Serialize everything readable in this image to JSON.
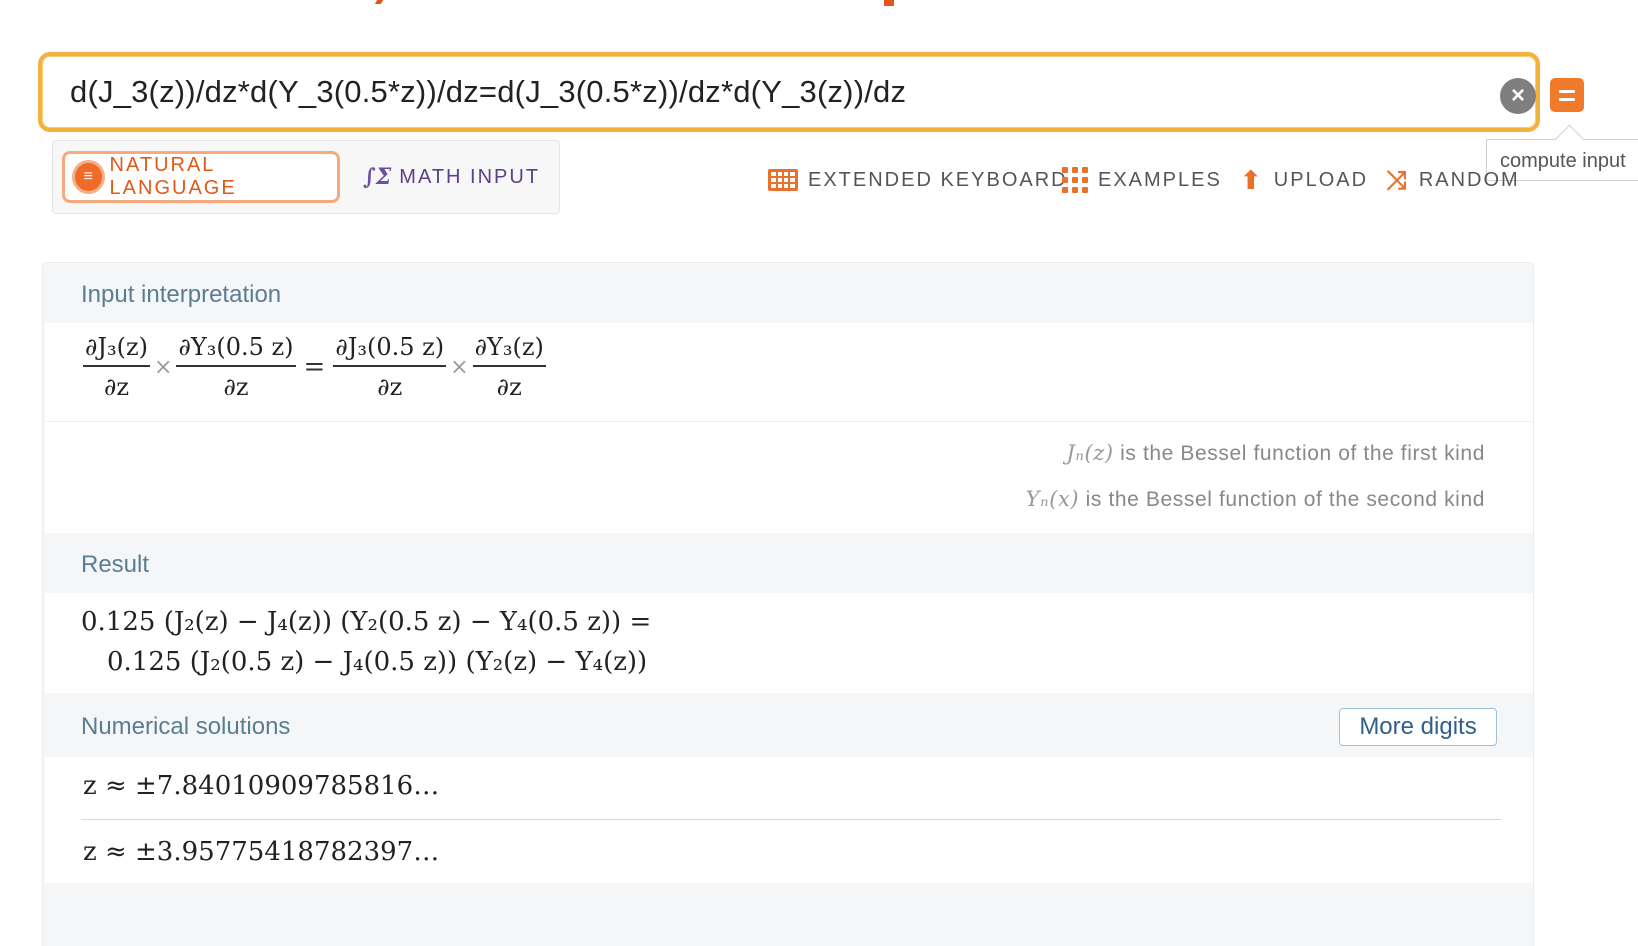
{
  "search": {
    "query": "d(J_3(z))/dz*d(Y_3(0.5*z))/dz=d(J_3(0.5*z))/dz*d(Y_3(z))/dz",
    "clear_icon": "close-icon",
    "compute_icon": "equals-icon",
    "tooltip": "compute input"
  },
  "modes": {
    "natural_language": "NATURAL LANGUAGE",
    "math_input": "MATH INPUT",
    "active": "natural_language"
  },
  "toolbar": {
    "extended_keyboard": "EXTENDED KEYBOARD",
    "examples": "EXAMPLES",
    "upload": "UPLOAD",
    "random": "RANDOM"
  },
  "pods": {
    "input_interpretation": {
      "title": "Input interpretation",
      "terms": [
        {
          "num": "∂J₃(z)",
          "den": "∂z"
        },
        {
          "num": "∂Y₃(0.5 z)",
          "den": "∂z"
        },
        {
          "num": "∂J₃(0.5 z)",
          "den": "∂z"
        },
        {
          "num": "∂Y₃(z)",
          "den": "∂z"
        }
      ],
      "times": "×",
      "equals": "=",
      "notes": [
        {
          "symbol": "Jₙ(z)",
          "text": " is the Bessel function of the first kind"
        },
        {
          "symbol": "Yₙ(x)",
          "text": " is the Bessel function of the second kind"
        }
      ]
    },
    "result": {
      "title": "Result",
      "line1": "0.125 (J₂(z) − J₄(z)) (Y₂(0.5 z) − Y₄(0.5 z)) =",
      "line2": "0.125 (J₂(0.5 z) − J₄(0.5 z)) (Y₂(z) − Y₄(z))"
    },
    "numerical_solutions": {
      "title": "Numerical solutions",
      "more_digits": "More digits",
      "solutions": [
        "z ≈ ±7.84010909785816…",
        "z ≈ ±3.95775418782397…"
      ]
    }
  },
  "colors": {
    "accent": "#f1792a",
    "search_border": "#f5b13d",
    "pod_title": "#5b7d92",
    "math_input": "#5a3f8a"
  }
}
